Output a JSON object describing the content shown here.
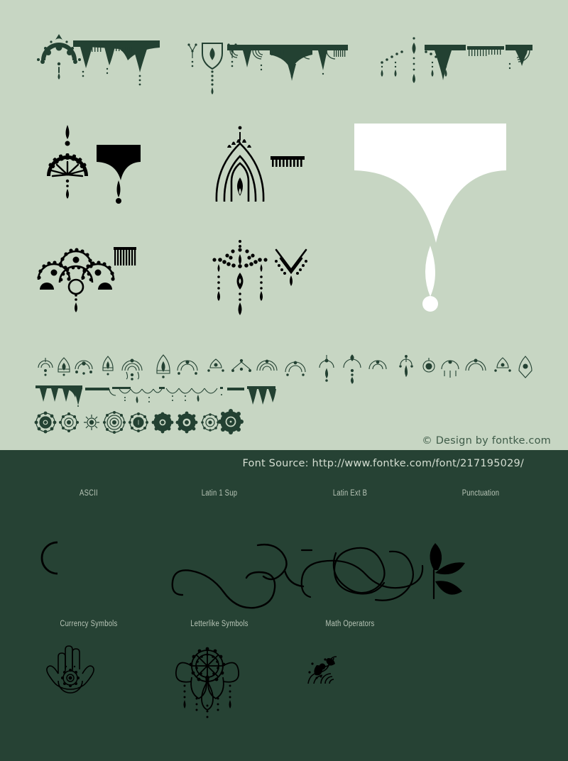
{
  "page": {
    "background_light": "#c7d6c3",
    "background_dark": "#264234",
    "glyph_dark_color": "#234132",
    "glyph_black_color": "#000000",
    "glyph_white_color": "#ffffff"
  },
  "credit": {
    "text": "© Design by fontke.com"
  },
  "source": {
    "text": "Font Source: http://www.fontke.com/font/217195029/"
  },
  "unicode_blocks": {
    "row1": [
      {
        "label": "ASCII"
      },
      {
        "label": "Latin 1 Sup"
      },
      {
        "label": "Latin Ext B"
      },
      {
        "label": "Punctuation"
      }
    ],
    "row2": [
      {
        "label": "Currency Symbols"
      },
      {
        "label": "Letterlike Symbols"
      },
      {
        "label": "Math Operators"
      }
    ]
  },
  "specimen": {
    "banner_row": {
      "samples": [
        {
          "name": "mandala-fan-border-left"
        },
        {
          "name": "draped-valance-border"
        },
        {
          "name": "shield-pendant-with-sprigs"
        },
        {
          "name": "scalloped-lace-valance"
        },
        {
          "name": "beaded-chandelier-swag"
        },
        {
          "name": "fringed-canopy-border"
        }
      ]
    },
    "large_row_1": {
      "samples": [
        {
          "name": "half-sun-fan-pendant"
        },
        {
          "name": "solid-tassel-banner"
        },
        {
          "name": "arched-shrine-motif"
        },
        {
          "name": "comb-fringe-bar"
        },
        {
          "name": "large-white-tassel-drop"
        }
      ]
    },
    "large_row_2": {
      "samples": [
        {
          "name": "triple-rosette-arch"
        },
        {
          "name": "comb-fringe-block"
        },
        {
          "name": "beaded-chandelier-drop"
        },
        {
          "name": "chevron-necklace-motif"
        }
      ]
    },
    "dense_row_1": {
      "name": "ornament-strip-small-a"
    },
    "dense_row_2": {
      "name": "ornament-strip-valance-b"
    },
    "dense_row_3": {
      "name": "ornament-strip-mandalas-c"
    },
    "dark_row_1": {
      "samples": [
        {
          "name": "crescent-moon-glyph"
        },
        {
          "name": "swash-flourish-glyph"
        },
        {
          "name": "knotted-flourish-leaf-glyph"
        }
      ]
    },
    "dark_row_2": {
      "samples": [
        {
          "name": "hamsa-hand-glyph"
        },
        {
          "name": "mandala-dreamcatcher-glyph"
        },
        {
          "name": "corner-paisley-glyph"
        }
      ]
    }
  }
}
